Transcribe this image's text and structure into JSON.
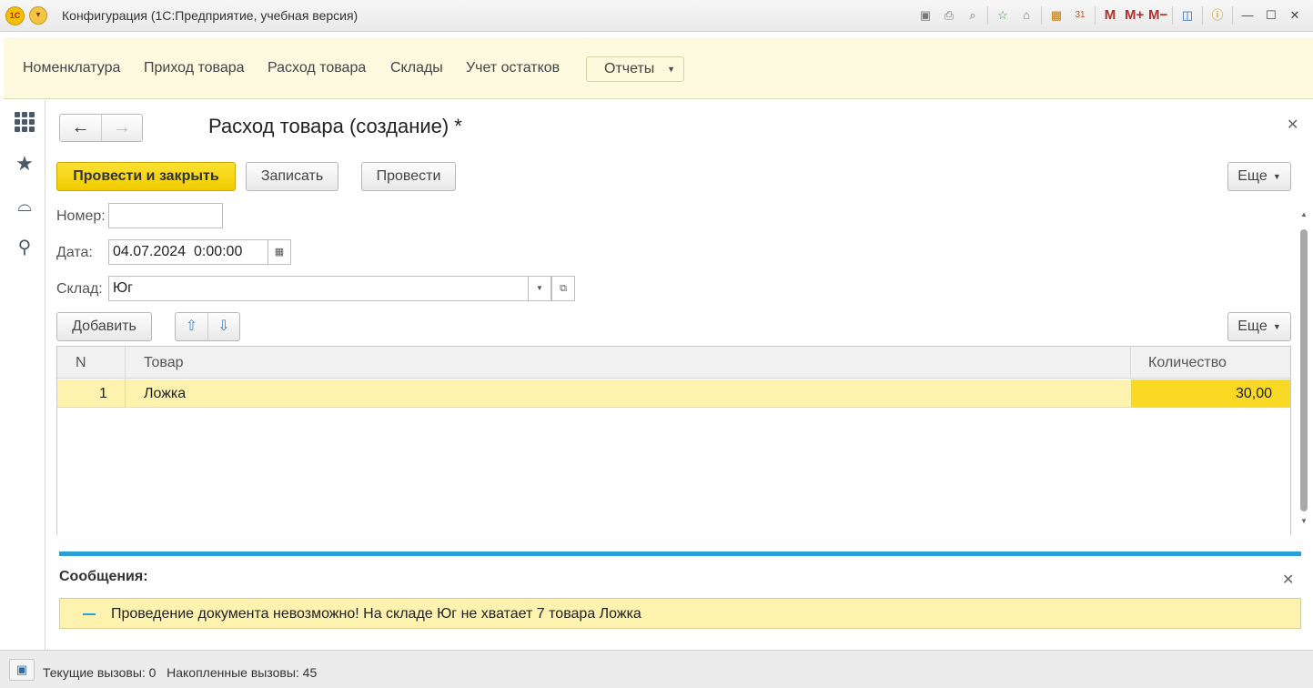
{
  "window": {
    "logo_text": "1C",
    "title": "Конфигурация  (1С:Предприятие, учебная версия)"
  },
  "toolbar_icons": [
    "save-icon",
    "print-icon",
    "preview-icon",
    "favorites-add-icon",
    "favorites-icon",
    "calculator-icon",
    "calendar-icon",
    "M",
    "M+",
    "M−",
    "panel-icon",
    "info-icon",
    "minimize-icon",
    "maximize-icon",
    "close-icon"
  ],
  "toolbar": {
    "m": "M",
    "m_plus": "M+",
    "m_minus": "M−",
    "calendar_day": "31"
  },
  "sections": {
    "items": [
      "Номенклатура",
      "Приход товара",
      "Расход товара",
      "Склады",
      "Учет остатков"
    ],
    "reports": "Отчеты"
  },
  "sidebar": [
    "apps-grid-icon",
    "star-icon",
    "history-icon",
    "search-icon"
  ],
  "form": {
    "title": "Расход товара (создание) *",
    "post_close": "Провести и закрыть",
    "save": "Записать",
    "post": "Провести",
    "more": "Еще",
    "number_label": "Номер:",
    "number_value": "",
    "date_label": "Дата:",
    "date_value": "04.07.2024  0:00:00",
    "warehouse_label": "Склад:",
    "warehouse_value": "Юг"
  },
  "table_toolbar": {
    "add": "Добавить",
    "more": "Еще"
  },
  "table": {
    "columns": [
      "N",
      "Товар",
      "Количество"
    ],
    "rows": [
      {
        "n": "1",
        "product": "Ложка",
        "quantity": "30,00"
      }
    ]
  },
  "messages": {
    "title": "Сообщения:",
    "items": [
      "Проведение документа невозможно! На складе Юг не хватает 7 товара Ложка"
    ]
  },
  "status": {
    "text": "Текущие вызовы: 0   Накопленные вызовы: 45"
  },
  "colors": {
    "accent_yellow": "#F9D923",
    "selection_row": "#FDF2AE",
    "message_line": "#2A9FD8",
    "sections_bg": "#FDFADF"
  }
}
